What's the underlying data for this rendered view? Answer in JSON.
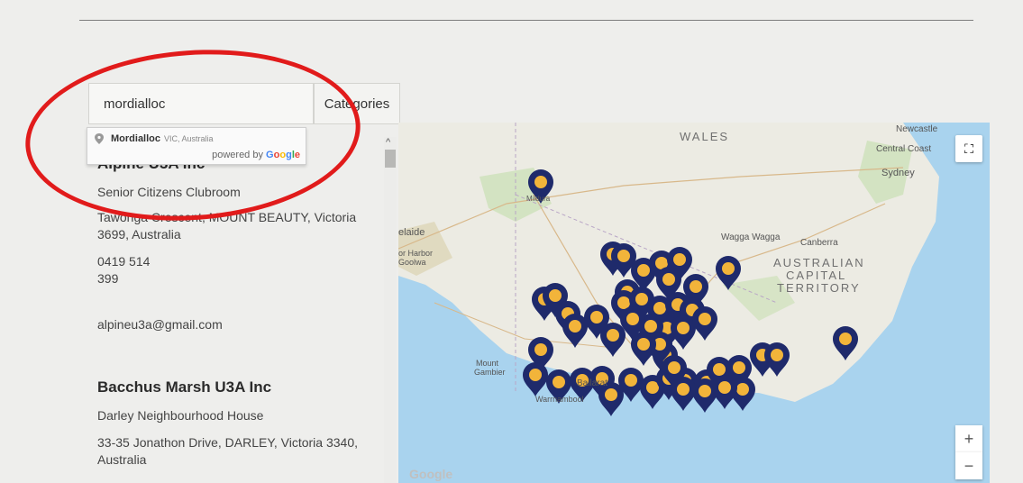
{
  "search": {
    "value": "mordiallоc",
    "categories_label": "Categories"
  },
  "autocomplete": {
    "item_main": "Mordialloc",
    "item_sub": "VIC, Australia",
    "powered_prefix": "powered by",
    "google_letters": [
      "G",
      "o",
      "o",
      "g",
      "l",
      "e"
    ]
  },
  "listings": [
    {
      "name": "Alpine U3A Inc",
      "venue": "Senior Citizens Clubroom",
      "address": "Tawonga Crescent, MOUNT BEAUTY, Victoria 3699, Australia",
      "phone_1": "0419 514",
      "phone_2": "399",
      "email": "alpineu3a@gmail.com"
    },
    {
      "name": "Bacchus Marsh U3A Inc",
      "venue": "Darley Neighbourhood House",
      "address": "33-35 Jonathon Drive, DARLEY, Victoria 3340, Australia"
    }
  ],
  "map": {
    "labels": {
      "wales": "WALES",
      "newcastle": "Newcastle",
      "central_coast": "Central Coast",
      "sydney": "Sydney",
      "wagga": "Wagga Wagga",
      "canberra": "Canberra",
      "act_1": "AUSTRALIAN",
      "act_2": "CAPITAL",
      "act_3": "TERRITORY",
      "adelaide": "elaide",
      "victor_harbor": "or Harbor",
      "goolwa": "Goolwa",
      "mildura": "Mildura",
      "mount_gambier_1": "Mount",
      "mount_gambier_2": "Gambier",
      "ballarat": "Ballarat",
      "warrnambool": "Warrnambool",
      "google": "Google"
    },
    "zoom_in": "+",
    "zoom_out": "−",
    "fullscreen_icon": "fullscreen-icon",
    "colors": {
      "marker": "#1f2a6b",
      "marker_dot": "#f2b43a",
      "water": "#a9d3ee",
      "land": "#ecebe3"
    }
  }
}
